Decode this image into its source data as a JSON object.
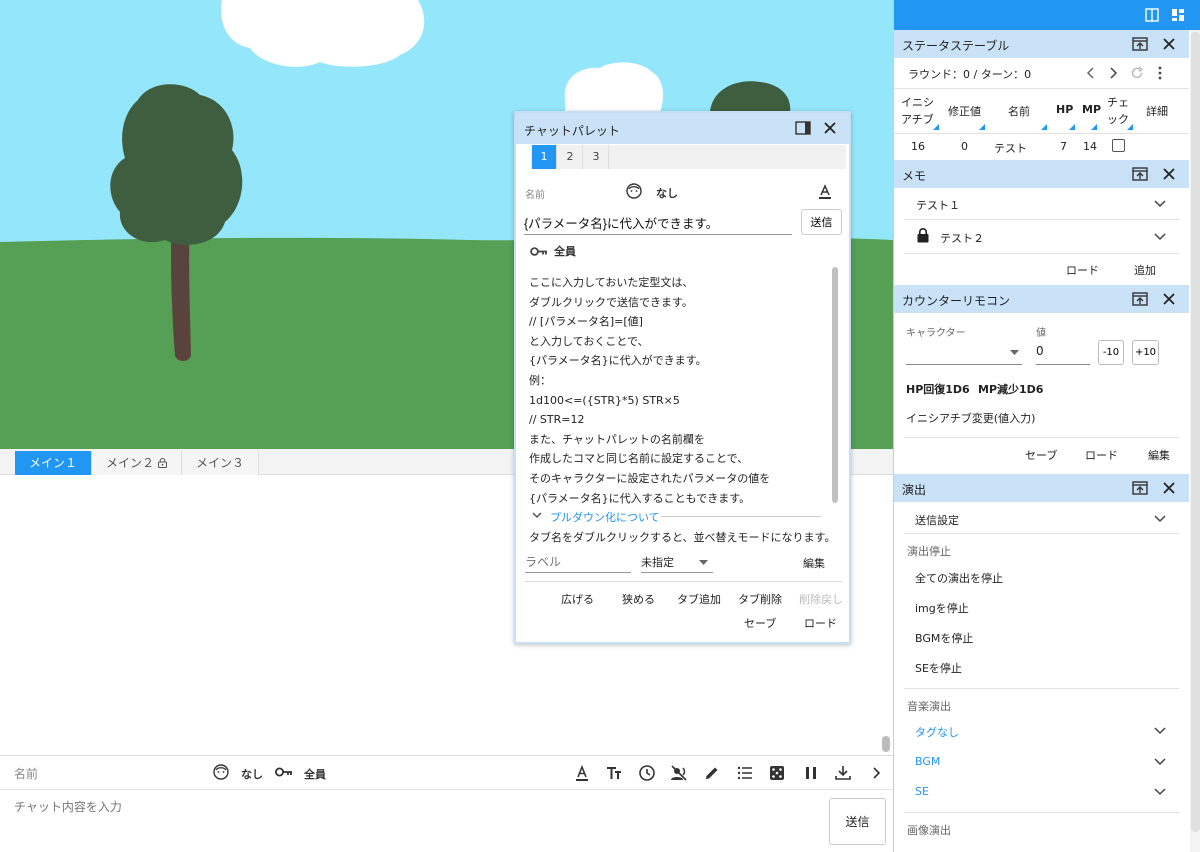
{
  "main_tabs": [
    {
      "label": "メイン１",
      "active": true
    },
    {
      "label": "メイン２",
      "locked": true
    },
    {
      "label": "メイン３"
    }
  ],
  "chat_bar": {
    "name_label": "名前",
    "character": "なし",
    "target": "全員",
    "placeholder": "チャット内容を入力",
    "send": "送信",
    "tools": [
      "font-color-icon",
      "text-size-icon",
      "clock-icon",
      "voice-off-icon",
      "pencil-icon",
      "list-icon",
      "dice-icon",
      "pause-icon",
      "download-icon",
      "chevron-right-icon"
    ]
  },
  "palette": {
    "title": "チャットパレット",
    "tabs": [
      "1",
      "2",
      "3"
    ],
    "name_label": "名前",
    "character": "なし",
    "input_value": "{パラメータ名}に代入ができます。",
    "send": "送信",
    "target": "全員",
    "lines": [
      "ここに入力しておいた定型文は、",
      "ダブルクリックで送信できます。",
      "// [パラメータ名]=[値]",
      "と入力しておくことで、",
      "{パラメータ名}に代入ができます。",
      "例：",
      "1d100<=({STR}*5) STR×5",
      "// STR=12",
      "また、チャットパレットの名前欄を",
      "作成したコマと同じ名前に設定することで、",
      "そのキャラクターに設定されたパラメータの値を",
      "{パラメータ名}に代入することもできます。"
    ],
    "pulldown": "プルダウン化について",
    "tab_hint": "タブ名をダブルクリックすると、並べ替えモードになります。",
    "label_placeholder": "ラベル",
    "select_value": "未指定",
    "edit": "編集",
    "actions": {
      "expand": "広げる",
      "narrow": "狭める",
      "add_tab": "タブ追加",
      "delete_tab": "タブ削除",
      "undo_delete": "削除戻し",
      "save": "セーブ",
      "load": "ロード"
    }
  },
  "status_table": {
    "title": "ステータステーブル",
    "round": "ラウンド：0 / ターン：0",
    "headers": [
      "イニシアチブ",
      "修正値",
      "名前",
      "HP",
      "MP",
      "チェック",
      "詳細"
    ],
    "header_lines": {
      "initiative": [
        "イニシ",
        "アチブ"
      ],
      "check": [
        "チェ",
        "ック"
      ]
    },
    "row": {
      "initiative": "16",
      "modifier": "0",
      "name": "テスト",
      "hp": "7",
      "mp": "14"
    }
  },
  "memo": {
    "title": "メモ",
    "items": [
      {
        "label": "テスト１"
      },
      {
        "label": "テスト２",
        "locked": true
      }
    ],
    "load": "ロード",
    "add": "追加"
  },
  "counter": {
    "title": "カウンターリモコン",
    "character_label": "キャラクター",
    "value_label": "値",
    "value": "0",
    "minus": "-10",
    "plus": "+10",
    "buttons": [
      "HP回復1D6",
      "MP減少1D6"
    ],
    "initiative_change": "イニシアチブ変更(値入力)",
    "save": "セーブ",
    "load": "ロード",
    "edit": "編集"
  },
  "effects": {
    "title": "演出",
    "send_settings": "送信設定",
    "stop_header": "演出停止",
    "stop_items": [
      "全ての演出を停止",
      "imgを停止",
      "BGMを停止",
      "SEを停止"
    ],
    "music_header": "音楽演出",
    "music_items": [
      "タグなし",
      "BGM",
      "SE"
    ],
    "image_header": "画像演出"
  },
  "colors": {
    "accent": "#2196f3",
    "panel_header": "#c9e2f8",
    "sky": "#94e6fb",
    "grass": "#56a055",
    "tree": "#3e5e3f",
    "trunk": "#5a433d"
  }
}
